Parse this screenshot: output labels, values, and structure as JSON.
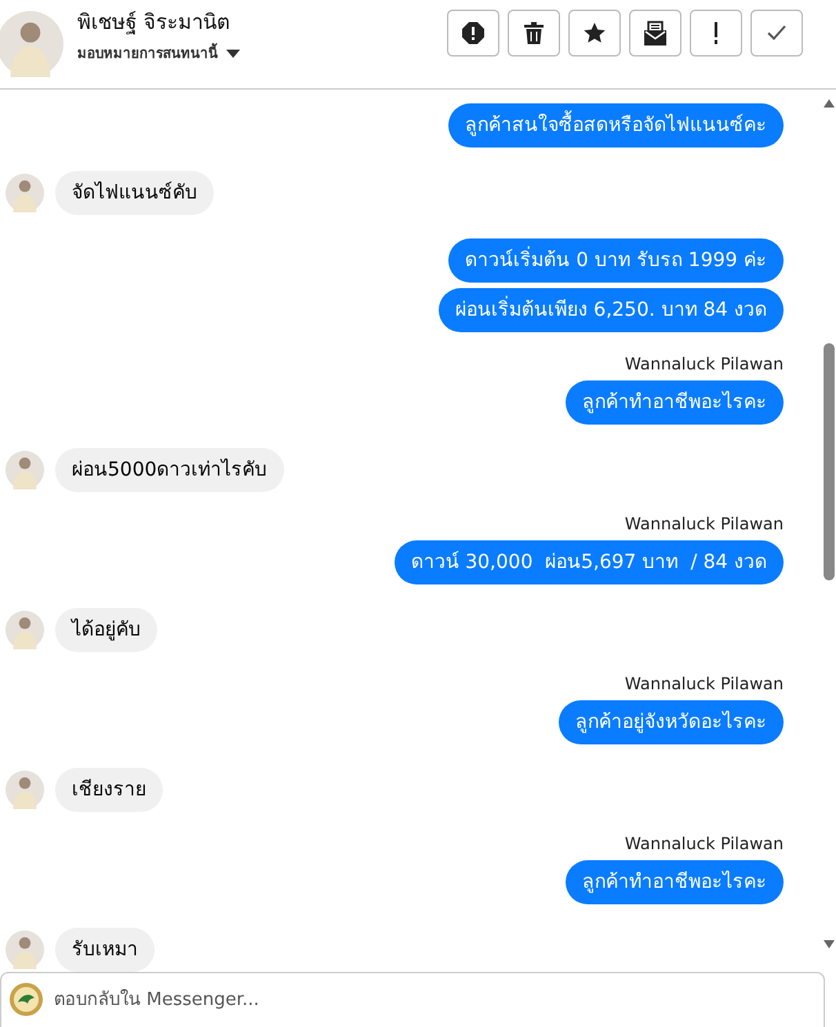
{
  "header": {
    "name": "พิเชษฐ์ จิระมานิต",
    "subtitle": "มอบหมายการสนทนานี้",
    "actions": [
      {
        "kind": "block"
      },
      {
        "kind": "trash"
      },
      {
        "kind": "star"
      },
      {
        "kind": "mail"
      },
      {
        "kind": "exclaim"
      },
      {
        "kind": "check"
      }
    ]
  },
  "messages": [
    {
      "kind": "outgoing",
      "text": "ลูกค้าสนใจซื้อสดหรือจัดไฟแนนซ์คะ"
    },
    {
      "kind": "incoming",
      "text": "จัดไฟแนนซ์คับ"
    },
    {
      "kind": "outgoing",
      "text": "ดาวน์เริ่มต้น 0 บาท รับรถ 1999 ค่ะ"
    },
    {
      "kind": "outgoing",
      "text": "ผ่อนเริ่มต้นเพียง 6,250. บาท 84 งวด"
    },
    {
      "kind": "outgoing",
      "sender": "Wannaluck Pilawan",
      "text": "ลูกค้าทำอาชีพอะไรคะ"
    },
    {
      "kind": "incoming",
      "text": "ผ่อน5000ดาวเท่าไรคับ"
    },
    {
      "kind": "outgoing",
      "sender": "Wannaluck Pilawan",
      "text": "ดาวน์ 30,000  ผ่อน5,697 บาท  / 84 งวด"
    },
    {
      "kind": "incoming",
      "text": "ได้อยู่คับ"
    },
    {
      "kind": "outgoing",
      "sender": "Wannaluck Pilawan",
      "text": "ลูกค้าอยู่จังหวัดอะไรคะ"
    },
    {
      "kind": "incoming",
      "text": "เชียงราย"
    },
    {
      "kind": "outgoing",
      "sender": "Wannaluck Pilawan",
      "text": "ลูกค้าทำอาชีพอะไรคะ"
    },
    {
      "kind": "incoming",
      "text": "รับเหมา"
    }
  ],
  "composer": {
    "placeholder": "ตอบกลับใน Messenger..."
  }
}
